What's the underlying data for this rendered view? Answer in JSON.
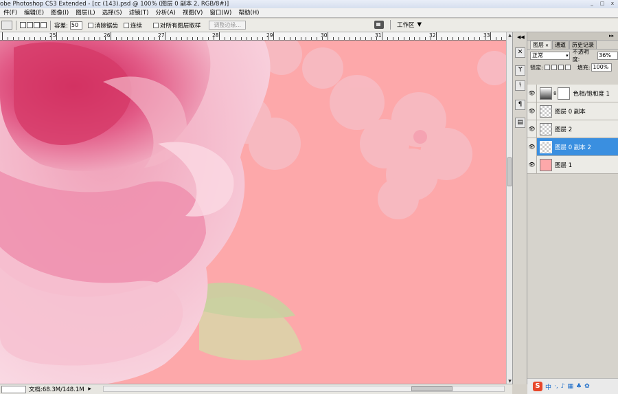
{
  "window": {
    "title": "obe Photoshop CS3 Extended - [cc (143).psd @ 100% (图层 0 副本 2, RGB/8#)]",
    "controls": [
      "_",
      "□",
      "x"
    ]
  },
  "menubar": {
    "items": [
      "件(F)",
      "编辑(E)",
      "图像(I)",
      "图层(L)",
      "选择(S)",
      "滤镜(T)",
      "分析(A)",
      "视图(V)",
      "窗口(W)",
      "帮助(H)"
    ]
  },
  "options": {
    "tolerance_label": "容差:",
    "tolerance_value": "50",
    "antialias_label": "消除锯齿",
    "contiguous_label": "连续",
    "sample_all_label": "对所有图层取样",
    "refine_edge_label": "调整边缘...",
    "workspace_label": "工作区"
  },
  "ruler": {
    "labels": [
      "25",
      "26",
      "27",
      "28",
      "29",
      "30",
      "31",
      "32",
      "33"
    ]
  },
  "status": {
    "doc_size": "文档:68.3M/148.1M"
  },
  "panel": {
    "tabs": [
      "图层",
      "通道",
      "历史记录"
    ],
    "blend_mode": "正常",
    "opacity_label": "不透明度:",
    "opacity_value": "36%",
    "lock_label": "锁定:",
    "fill_label": "填充:",
    "fill_value": "100%",
    "layers": [
      {
        "name": "色相/饱和度 1",
        "selected": false
      },
      {
        "name": "图层 0 副本",
        "selected": false
      },
      {
        "name": "图层 2",
        "selected": false
      },
      {
        "name": "图层 0 副本 2",
        "selected": true
      },
      {
        "name": "图层 1",
        "selected": false
      }
    ]
  },
  "taskbar": {
    "ime_label": "中"
  },
  "colors": {
    "canvas_pink": "#fda8aa",
    "selection_blue": "#3a8fe0"
  }
}
